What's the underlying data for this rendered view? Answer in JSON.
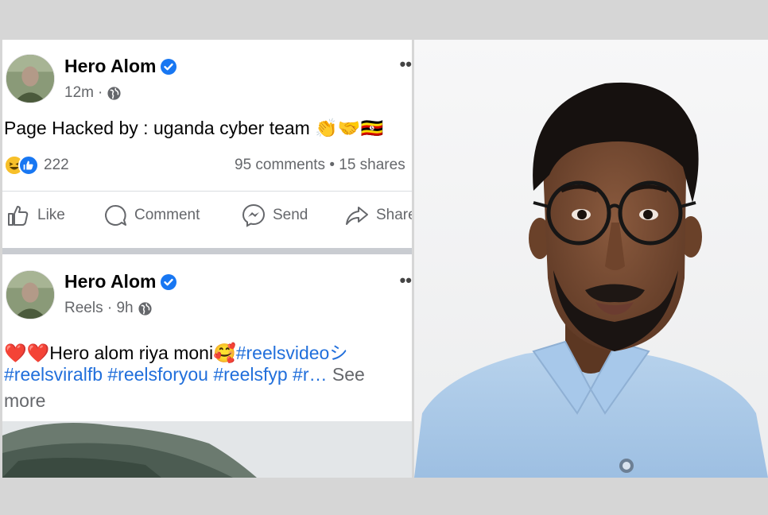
{
  "post1": {
    "author": "Hero Alom",
    "time": "12m",
    "text": "Page Hacked by : uganda cyber team 👏🤝🇺🇬",
    "reaction_count": "222",
    "stats": "95 comments • 15 shares",
    "more": "••",
    "actions": {
      "like": "Like",
      "comment": "Comment",
      "send": "Send",
      "share": "Share"
    }
  },
  "post2": {
    "author": "Hero Alom",
    "meta_prefix": "Reels · 9h",
    "more": "••",
    "line1_prefix": "❤️❤️Hero alom riya moni🥰",
    "line1_tag": "#reelsvideoシ",
    "line2_tags": "#reelsviralfb #reelsforyou #reelsfyp #r…",
    "line2_see": "See",
    "line3": "more"
  },
  "colors": {
    "verified": "#1877f2",
    "hashtag": "#216fdb",
    "meta": "#65676b",
    "shirt": "#a9c9e8"
  },
  "icons": [
    "verified-badge-icon",
    "globe-icon",
    "haha-reaction-icon",
    "like-reaction-icon",
    "like-icon",
    "comment-icon",
    "messenger-icon",
    "share-icon",
    "more-icon"
  ]
}
